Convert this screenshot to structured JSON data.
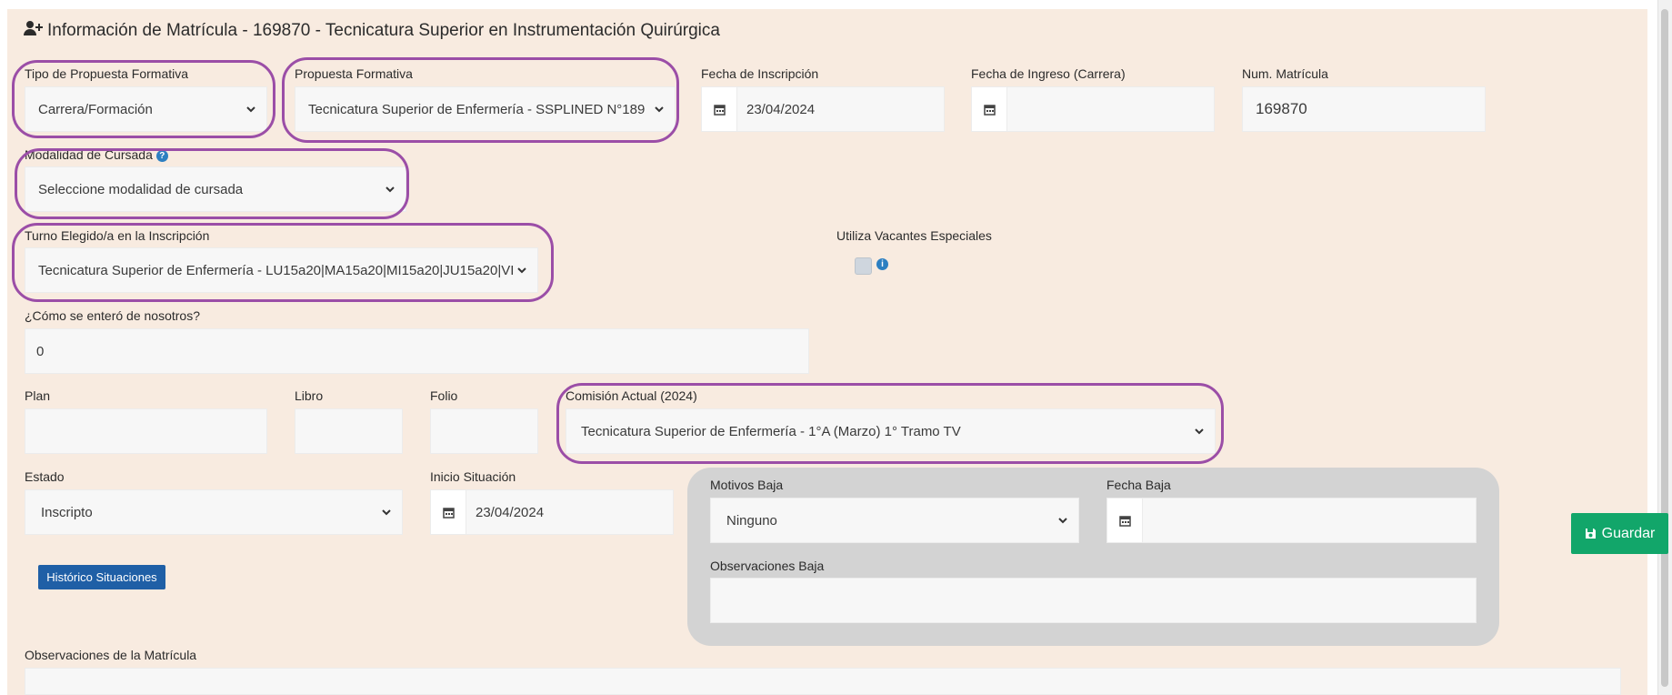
{
  "header": {
    "title": "Información de Matrícula - 169870 - Tecnicatura Superior en Instrumentación Quirúrgica"
  },
  "fields": {
    "tipo_propuesta": {
      "label": "Tipo de Propuesta Formativa",
      "value": "Carrera/Formación"
    },
    "propuesta": {
      "label": "Propuesta Formativa",
      "value": "Tecnicatura Superior de Enfermería - SSPLINED N°189"
    },
    "fecha_inscripcion": {
      "label": "Fecha de Inscripción",
      "value": "23/04/2024"
    },
    "fecha_ingreso": {
      "label": "Fecha de Ingreso (Carrera)",
      "value": ""
    },
    "num_matricula": {
      "label": "Num. Matrícula",
      "value": "169870"
    },
    "modalidad": {
      "label": "Modalidad de Cursada",
      "value": "Seleccione modalidad de cursada"
    },
    "turno": {
      "label": "Turno Elegido/a en la Inscripción",
      "value": "Tecnicatura Superior de Enfermería - LU15a20|MA15a20|MI15a20|JU15a20|VI"
    },
    "vacantes": {
      "label": "Utiliza Vacantes Especiales",
      "checked": false
    },
    "como_se_entero": {
      "label": "¿Cómo se enteró de nosotros?",
      "value": "0"
    },
    "plan": {
      "label": "Plan",
      "value": ""
    },
    "libro": {
      "label": "Libro",
      "value": ""
    },
    "folio": {
      "label": "Folio",
      "value": ""
    },
    "comision": {
      "label": "Comisión Actual (2024)",
      "value": "Tecnicatura Superior de Enfermería - 1°A (Marzo) 1° Tramo TV"
    },
    "estado": {
      "label": "Estado",
      "value": "Inscripto"
    },
    "inicio_situacion": {
      "label": "Inicio Situación",
      "value": "23/04/2024"
    },
    "motivos_baja": {
      "label": "Motivos Baja",
      "value": "Ninguno"
    },
    "fecha_baja": {
      "label": "Fecha Baja",
      "value": ""
    },
    "observaciones_baja": {
      "label": "Observaciones Baja",
      "value": ""
    },
    "observaciones_matricula": {
      "label": "Observaciones de la Matrícula",
      "value": ""
    }
  },
  "buttons": {
    "historico": "Histórico Situaciones",
    "guardar": "Guardar"
  },
  "icons": {
    "title_icon": "user-plus-icon",
    "calendar": "calendar-icon",
    "help": "help-icon",
    "info": "info-icon",
    "save": "save-icon",
    "caret": "chevron-down-icon"
  },
  "colors": {
    "panel_bg": "#f8ebe0",
    "highlight": "#9b4ea7",
    "save_button": "#12a66a",
    "history_button": "#1f5fa6",
    "help_icon": "#2d7fc1"
  }
}
